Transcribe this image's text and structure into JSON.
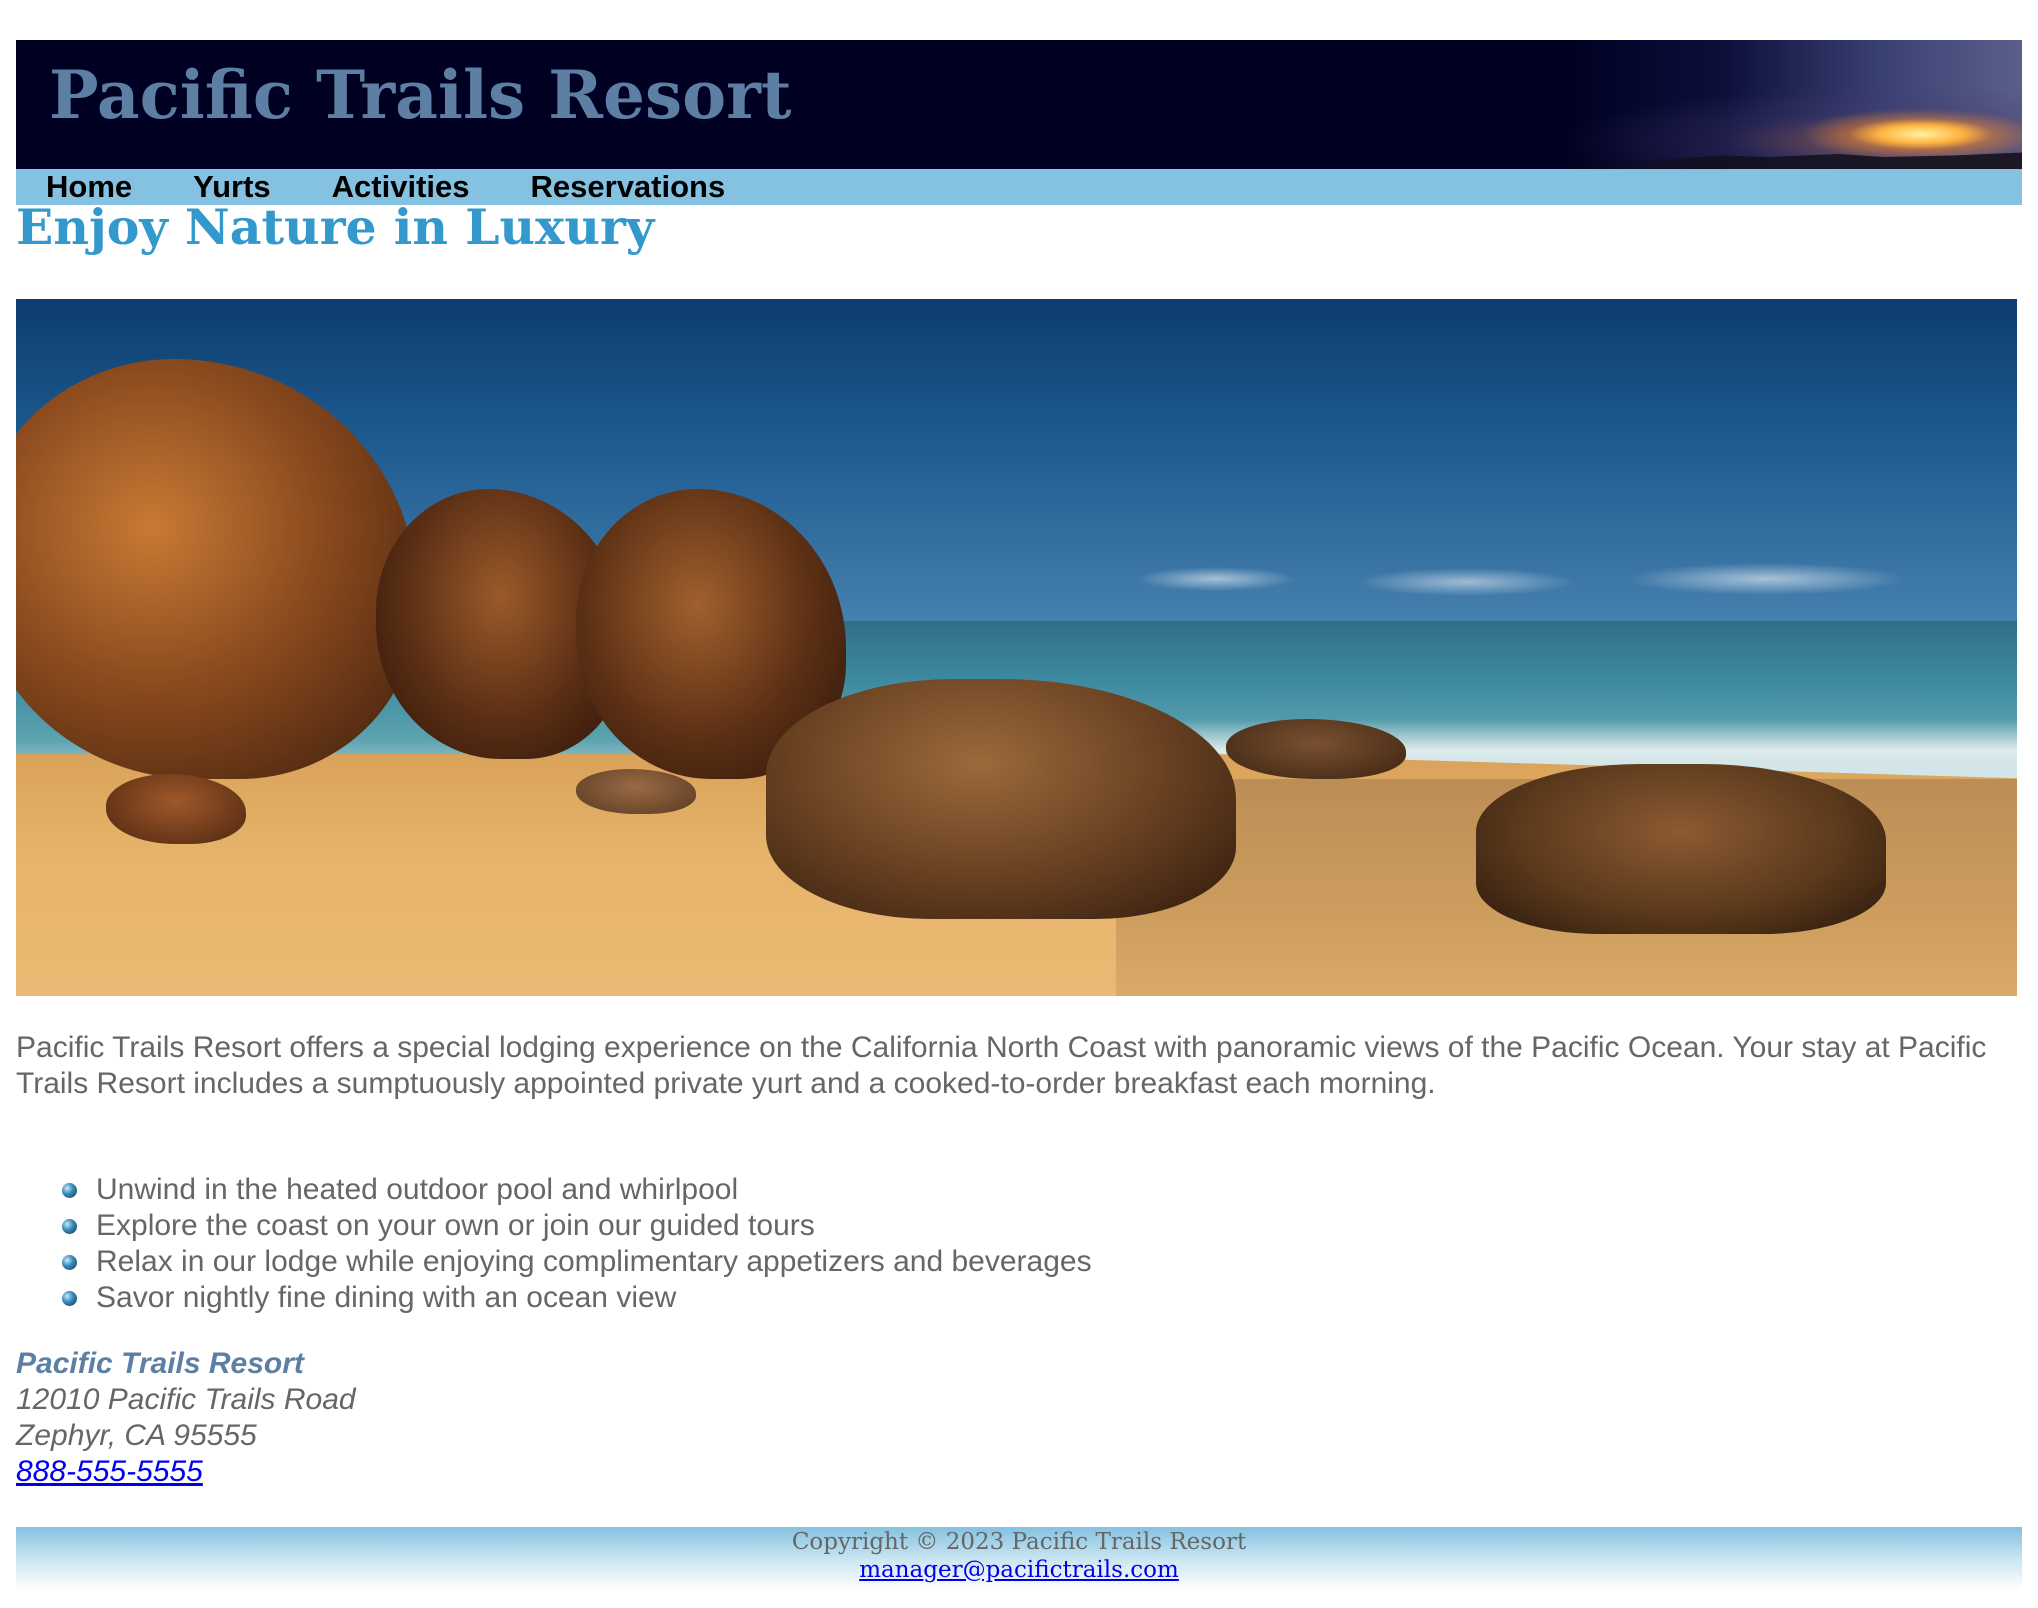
{
  "header": {
    "title": "Pacific Trails Resort"
  },
  "nav": {
    "items": [
      {
        "label": "Home"
      },
      {
        "label": "Yurts"
      },
      {
        "label": "Activities"
      },
      {
        "label": "Reservations"
      }
    ]
  },
  "main": {
    "heading": "Enjoy Nature in Luxury",
    "hero_image": "beach-coastline-image",
    "intro": "Pacific Trails Resort offers a special lodging experience on the California North Coast with panoramic views of the Pacific Ocean. Your stay at Pacific Trails Resort includes a sumptuously appointed private yurt and a cooked-to-order breakfast each morning.",
    "features": [
      "Unwind in the heated outdoor pool and whirlpool",
      "Explore the coast on your own or join our guided tours",
      "Relax in our lodge while enjoying complimentary appetizers and beverages",
      "Savor nightly fine dining with an ocean view"
    ],
    "address": {
      "name": "Pacific Trails Resort",
      "street": "12010 Pacific Trails Road",
      "city_state_zip": "Zephyr, CA 95555",
      "phone": "888-555-5555"
    }
  },
  "footer": {
    "copyright": "Copyright © 2023 Pacific Trails Resort",
    "email": "manager@pacifictrails.com"
  },
  "colors": {
    "header_bg": "#000022",
    "title": "#5c7fa3",
    "nav_bg": "#85c1e0",
    "heading": "#3399cc",
    "text": "#666666",
    "link": "#0000ee"
  }
}
